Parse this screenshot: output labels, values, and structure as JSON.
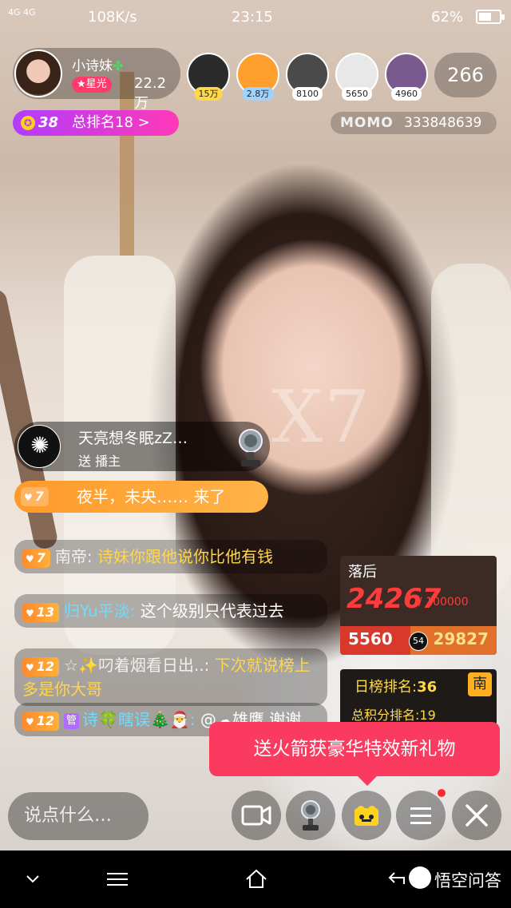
{
  "status_bar": {
    "signal": "4G 4G",
    "speed": "108K/s",
    "time": "23:15",
    "battery": "62%",
    "battery_level": 0.62
  },
  "host": {
    "name": "小诗妹",
    "star_badge": "★星光",
    "fans": "22.2万"
  },
  "top_viewers": [
    {
      "badge": "15万",
      "color": "#2b2b2b"
    },
    {
      "badge": "2.8万",
      "color": "#ff9f2e"
    },
    {
      "badge": "8100",
      "color": "#4a4a4a"
    },
    {
      "badge": "5650",
      "color": "#e8e8e8"
    },
    {
      "badge": "4960",
      "color": "#7a5a8e"
    }
  ],
  "viewer_count": "266",
  "rank": {
    "level": "38",
    "text": "总排名18 >"
  },
  "momo": {
    "logo": "MOMO",
    "id": "333848639"
  },
  "video_watermark": "X7",
  "gift_notification": {
    "user": "天亮想冬眠zZ…",
    "desc": "送 播主"
  },
  "enter_message": {
    "level": "7",
    "text": "夜半，未央……  来了"
  },
  "chat": [
    {
      "level": "7",
      "user": "南帝:",
      "message": "诗妹你跟他说你比他有钱"
    },
    {
      "level": "13",
      "user": "归Yu平淡:",
      "message": "这个级别只代表过去"
    },
    {
      "level": "12",
      "user": "☆✨叼着烟看日出..:",
      "message": "下次就说榜上多是你大哥"
    },
    {
      "level": "12",
      "admin": "管",
      "user": "诗🍀瞎误🎄🎅:",
      "message": "@☁雄鹰 谢谢"
    }
  ],
  "pk": {
    "status": "落后",
    "score": "24267",
    "target": "/ 100000",
    "left": "5560",
    "timer": "54",
    "right": "29827",
    "left_share": 0.16
  },
  "daily_rank": {
    "label": "日榜排名:",
    "value": "36",
    "badge": "南",
    "total_label": "总积分排名:",
    "total_value": "19"
  },
  "tooltip": "送火箭获豪华特效新礼物",
  "input_placeholder": "说点什么…",
  "brand": "悟空问答"
}
